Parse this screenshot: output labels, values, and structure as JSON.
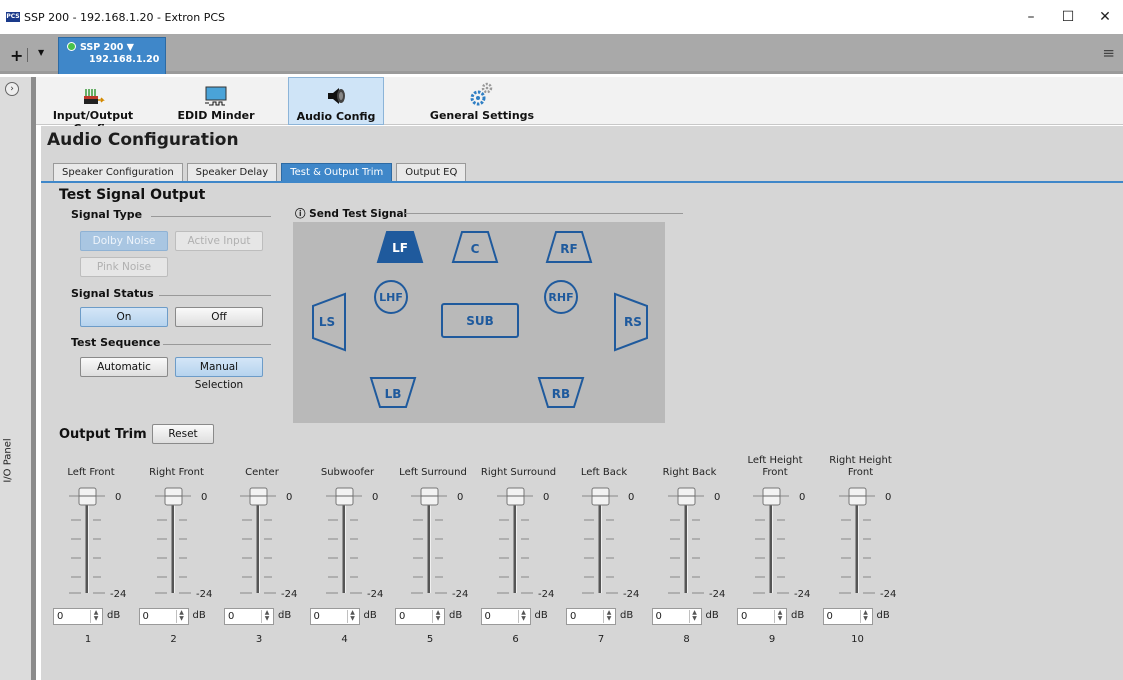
{
  "window": {
    "title": "SSP 200 - 192.168.1.20 - Extron PCS",
    "app_icon": "PCS",
    "minimize": "–",
    "maximize": "☐",
    "close": "✕"
  },
  "device_tab": {
    "name": "SSP 200 ▼",
    "ip": "192.168.1.20",
    "status_color": "#49c24b"
  },
  "io_panel": {
    "label": "I/O Panel"
  },
  "toolbar": [
    {
      "label": "Input/Output Config",
      "icon": "io-config-icon"
    },
    {
      "label": "EDID Minder",
      "icon": "edid-monitor-icon"
    },
    {
      "label": "Audio Config",
      "icon": "speaker-icon",
      "active": true
    },
    {
      "label": "General Settings",
      "icon": "gears-icon"
    }
  ],
  "page_title": "Audio Configuration",
  "tabs": [
    {
      "label": "Speaker Configuration"
    },
    {
      "label": "Speaker Delay"
    },
    {
      "label": "Test & Output Trim",
      "active": true
    },
    {
      "label": "Output EQ"
    }
  ],
  "test_signal": {
    "title": "Test Signal Output",
    "signal_type": {
      "label": "Signal Type",
      "dolby": "Dolby Noise",
      "active_input": "Active Input",
      "pink": "Pink Noise"
    },
    "signal_status": {
      "label": "Signal Status",
      "on": "On",
      "off": "Off"
    },
    "test_sequence": {
      "label": "Test Sequence",
      "automatic": "Automatic",
      "manual": "Manual Selection"
    },
    "send_label": "ⓘ Send Test Signal",
    "speakers": {
      "LF": "LF",
      "C": "C",
      "RF": "RF",
      "LHF": "LHF",
      "RHF": "RHF",
      "LS": "LS",
      "SUB": "SUB",
      "RS": "RS",
      "LB": "LB",
      "RB": "RB"
    },
    "selected": "LF"
  },
  "output_trim": {
    "title": "Output Trim",
    "reset": "Reset",
    "scale_top": "0",
    "scale_bottom": "-24",
    "unit": "dB",
    "spin_up": "▲",
    "spin_down": "▼",
    "channels": [
      {
        "name": "Left Front",
        "value": "0",
        "num": "1"
      },
      {
        "name": "Right Front",
        "value": "0",
        "num": "2"
      },
      {
        "name": "Center",
        "value": "0",
        "num": "3"
      },
      {
        "name": "Subwoofer",
        "value": "0",
        "num": "4"
      },
      {
        "name": "Left Surround",
        "value": "0",
        "num": "5"
      },
      {
        "name": "Right Surround",
        "value": "0",
        "num": "6"
      },
      {
        "name": "Left Back",
        "value": "0",
        "num": "7"
      },
      {
        "name": "Right Back",
        "value": "0",
        "num": "8"
      },
      {
        "name": "Left Height Front",
        "value": "0",
        "num": "9"
      },
      {
        "name": "Right Height Front",
        "value": "0",
        "num": "10"
      }
    ]
  },
  "colors": {
    "accent": "#3f87c9",
    "speaker": "#1f5a9d",
    "panel": "#d6d6d6",
    "test_area": "#b9b9b9"
  }
}
